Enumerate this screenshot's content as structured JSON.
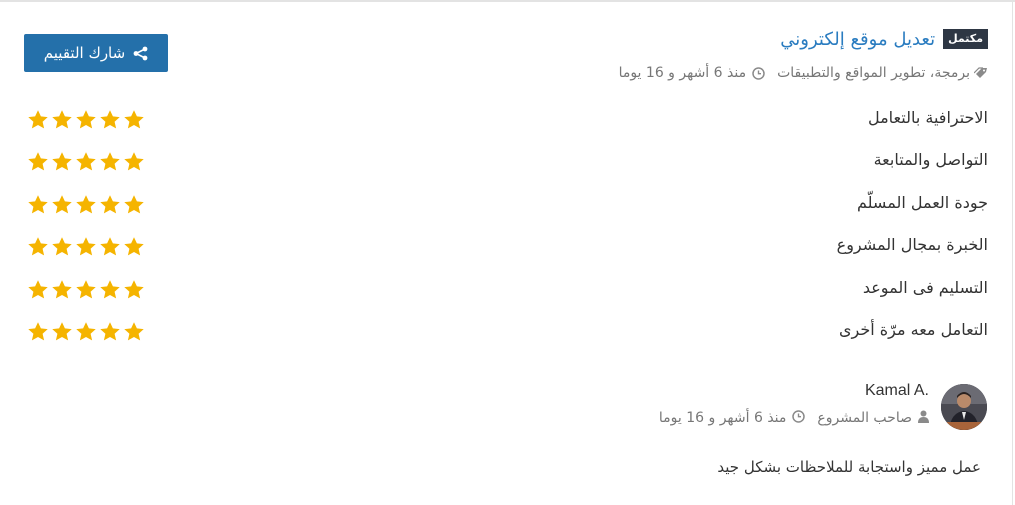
{
  "project": {
    "status_badge": "مكتمل",
    "title": "تعديل موقع إلكتروني",
    "category": "برمجة، تطوير المواقع والتطبيقات",
    "time_ago": "منذ 6 أشهر و 16 يوما",
    "icons": {
      "category": "tags-icon",
      "time": "clock-icon"
    }
  },
  "share_button": {
    "label": "شارك التقييم",
    "icon": "share-icon",
    "color": "#2470aa"
  },
  "ratings": [
    {
      "label": "الاحترافية بالتعامل",
      "stars": 5,
      "max": 5
    },
    {
      "label": "التواصل والمتابعة",
      "stars": 5,
      "max": 5
    },
    {
      "label": "جودة العمل المسلّم",
      "stars": 5,
      "max": 5
    },
    {
      "label": "الخبرة بمجال المشروع",
      "stars": 5,
      "max": 5
    },
    {
      "label": "التسليم فى الموعد",
      "stars": 5,
      "max": 5
    },
    {
      "label": "التعامل معه مرّة أخرى",
      "stars": 5,
      "max": 5
    }
  ],
  "star_color": "#f5b400",
  "reviewer": {
    "name": "Kamal A.",
    "role": "صاحب المشروع",
    "time_ago": "منذ 6 أشهر و 16 يوما",
    "comment": "عمل مميز واستجابة للملاحظات بشكل جيد"
  },
  "colors": {
    "link": "#2a7cc0",
    "badge_bg": "#2e3744"
  }
}
